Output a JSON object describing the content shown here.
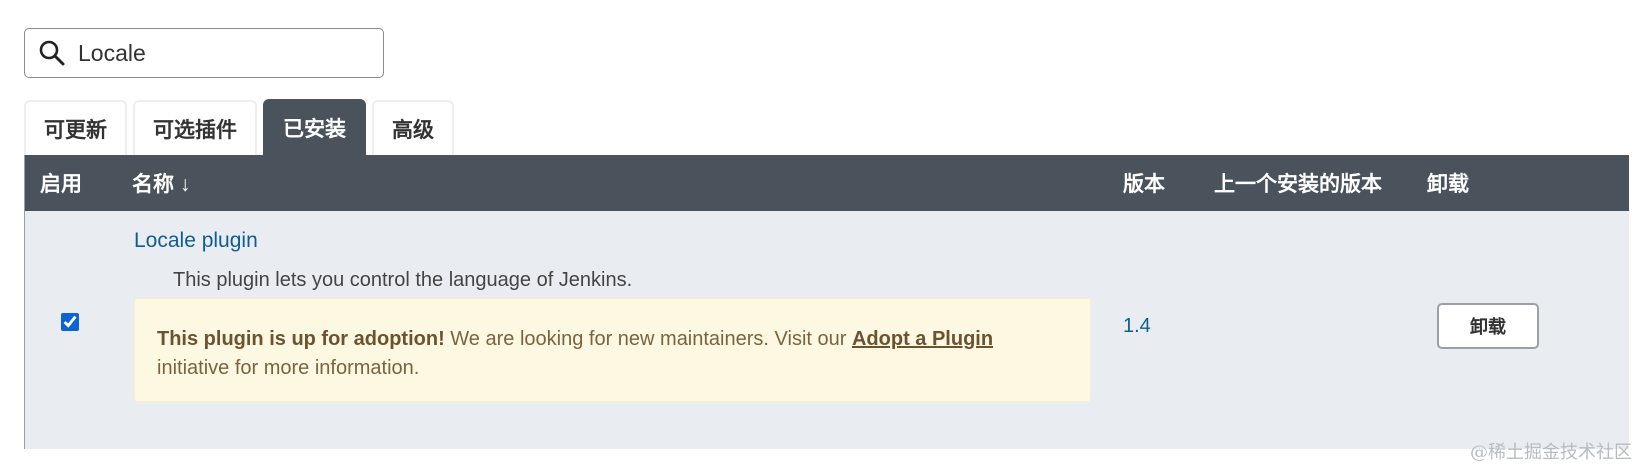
{
  "search": {
    "value": "Locale",
    "icon": "search-icon"
  },
  "tabs": [
    {
      "label": "可更新",
      "active": false
    },
    {
      "label": "可选插件",
      "active": false
    },
    {
      "label": "已安装",
      "active": true
    },
    {
      "label": "高级",
      "active": false
    }
  ],
  "table": {
    "headers": {
      "enabled": "启用",
      "name": "名称 ↓",
      "version": "版本",
      "previous_version": "上一个安装的版本",
      "uninstall": "卸载"
    },
    "rows": [
      {
        "enabled": true,
        "name": "Locale plugin",
        "description": "This plugin lets you control the language of Jenkins.",
        "adoption": {
          "strong": "This plugin is up for adoption!",
          "text_before_link": " We are looking for new maintainers. Visit our ",
          "link": "Adopt a Plugin",
          "text_after_link": " initiative for more information."
        },
        "version": "1.4",
        "previous_version": "",
        "uninstall_label": "卸载"
      }
    ]
  },
  "watermark": "@稀土掘金技术社区",
  "colors": {
    "header_bg": "#4a525c",
    "row_bg": "#e9edf2",
    "link": "#0f5e8f",
    "adoption_bg": "#fdf8e1",
    "adoption_text": "#7a6440"
  }
}
